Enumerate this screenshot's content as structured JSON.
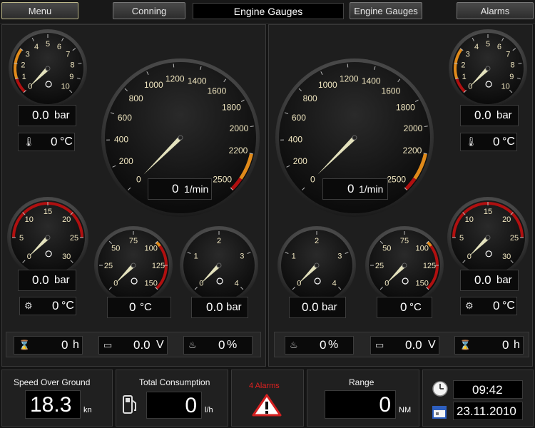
{
  "topbar": {
    "menu_label": "Menu",
    "conning_label": "Conning",
    "title": "Engine Gauges",
    "engine_gauges_label": "Engine Gauges",
    "alarms_label": "Alarms"
  },
  "colors": {
    "needle": "#ffffcc",
    "accent_red": "#b01010",
    "accent_orange": "#e08a1a",
    "tick_text": "#f0e6c0"
  },
  "left_engine": {
    "oil_pressure": {
      "value": "0.0",
      "unit": "bar",
      "ticks": [
        "0",
        "1",
        "2",
        "3",
        "4",
        "5",
        "6",
        "7",
        "8",
        "9",
        "10"
      ],
      "icon": "oil-pressure-icon"
    },
    "oil_temp": {
      "value": "0",
      "unit": "°C",
      "icon": "oil-temp-icon"
    },
    "rpm": {
      "value": "0",
      "unit": "1/min",
      "ticks": [
        "0",
        "200",
        "400",
        "600",
        "800",
        "1000",
        "1200",
        "1400",
        "1600",
        "1800",
        "2000",
        "2200",
        "2500"
      ]
    },
    "fuel_pressure": {
      "value": "0.0",
      "unit": "bar",
      "ticks": [
        "0",
        "5",
        "10",
        "15",
        "20",
        "25",
        "30"
      ],
      "icon": "fuel-pressure-icon"
    },
    "gear_temp": {
      "value": "0",
      "unit": "°C",
      "icon": "gear-temp-icon"
    },
    "coolant_temp": {
      "value": "0",
      "unit": "°C",
      "ticks": [
        "0",
        "25",
        "50",
        "75",
        "100",
        "125",
        "150"
      ],
      "icon": "coolant-temp-icon"
    },
    "turbo_pressure": {
      "value": "0.0",
      "unit": "bar",
      "ticks": [
        "0",
        "1",
        "2",
        "3",
        "4"
      ],
      "icon": "turbo-icon"
    },
    "hours": {
      "value": "0",
      "unit": "h",
      "icon": "hourglass-icon"
    },
    "voltage": {
      "value": "0.0",
      "unit": "V",
      "icon": "battery-icon"
    },
    "load": {
      "value": "0",
      "unit": "%",
      "icon": "engine-load-icon"
    }
  },
  "right_engine": {
    "oil_pressure": {
      "value": "0.0",
      "unit": "bar",
      "icon": "oil-pressure-icon"
    },
    "oil_temp": {
      "value": "0",
      "unit": "°C",
      "icon": "oil-temp-icon"
    },
    "rpm": {
      "value": "0",
      "unit": "1/min"
    },
    "fuel_pressure": {
      "value": "0.0",
      "unit": "bar",
      "icon": "fuel-pressure-icon"
    },
    "gear_temp": {
      "value": "0",
      "unit": "°C",
      "icon": "gear-temp-icon"
    },
    "coolant_temp": {
      "value": "0",
      "unit": "°C",
      "icon": "coolant-temp-icon"
    },
    "turbo_pressure": {
      "value": "0.0",
      "unit": "bar",
      "icon": "turbo-icon"
    },
    "hours": {
      "value": "0",
      "unit": "h",
      "icon": "hourglass-icon"
    },
    "voltage": {
      "value": "0.0",
      "unit": "V",
      "icon": "battery-icon"
    },
    "load": {
      "value": "0",
      "unit": "%",
      "icon": "engine-load-icon"
    }
  },
  "status": {
    "sog_label": "Speed Over Ground",
    "sog_value": "18.3",
    "sog_unit": "kn",
    "consumption_label": "Total Consumption",
    "consumption_value": "0",
    "consumption_unit": "l/h",
    "alarms_text": "4 Alarms",
    "range_label": "Range",
    "range_value": "0",
    "range_unit": "NM",
    "time": "09:42",
    "date": "23.11.2010"
  }
}
